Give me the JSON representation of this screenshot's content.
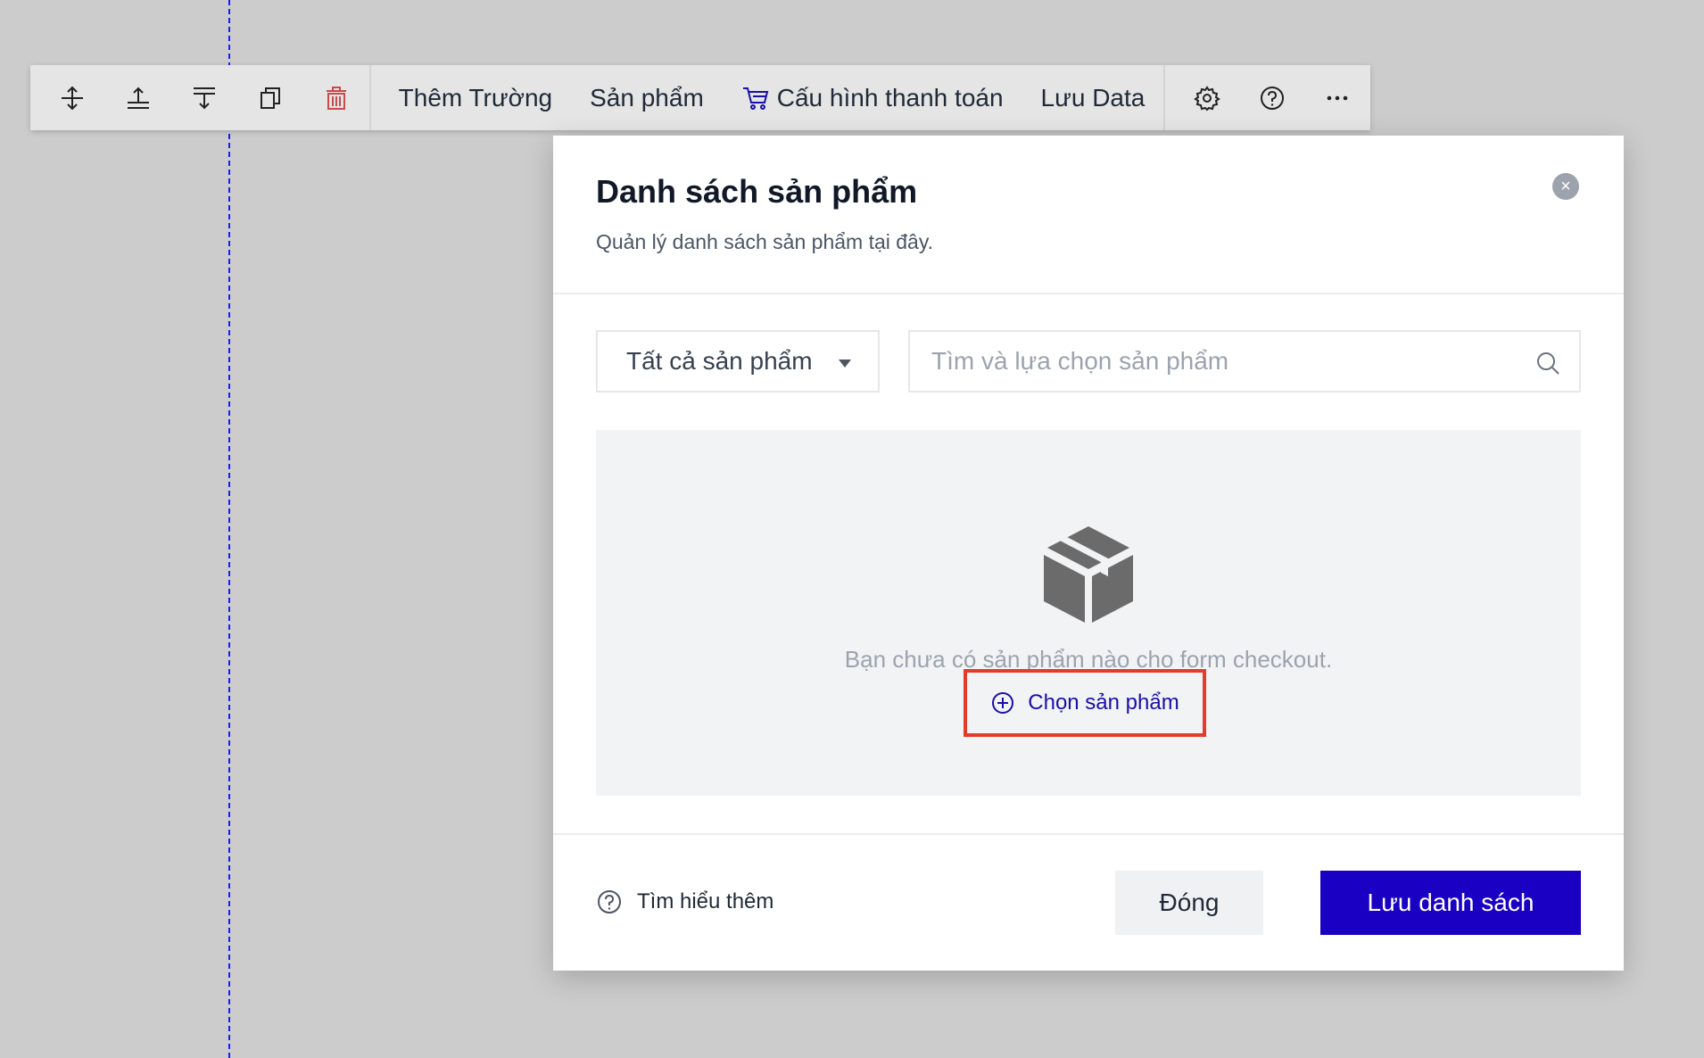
{
  "toolbar": {
    "icons_left": [
      "move-up-down-icon",
      "insert-above-icon",
      "insert-below-icon",
      "duplicate-icon",
      "trash-icon"
    ],
    "items": {
      "add_field": "Thêm Trường",
      "products": "Sản phẩm",
      "payment_config": "Cấu hình thanh toán",
      "save_data": "Lưu Data"
    },
    "icons_right": [
      "gear-icon",
      "help-icon",
      "more-icon"
    ],
    "delete_color": "#c94a4a",
    "cart_color": "#1a0fa8"
  },
  "modal": {
    "title": "Danh sách sản phẩm",
    "subtitle": "Quản lý danh sách sản phẩm tại đây.",
    "close_symbol": "×",
    "filter": {
      "selected": "Tất cả sản phẩm"
    },
    "search": {
      "placeholder": "Tìm và lựa chọn sản phẩm",
      "value": ""
    },
    "empty_state": {
      "message": "Bạn chưa có sản phẩm nào cho form checkout.",
      "action_label": "Chọn sản phẩm"
    },
    "footer": {
      "learn_more": "Tìm hiểu thêm",
      "close_label": "Đóng",
      "save_label": "Lưu danh sách"
    }
  },
  "colors": {
    "primary": "#1a00c2",
    "highlight_border": "#e53b2a",
    "backdrop": "#cccccc"
  }
}
